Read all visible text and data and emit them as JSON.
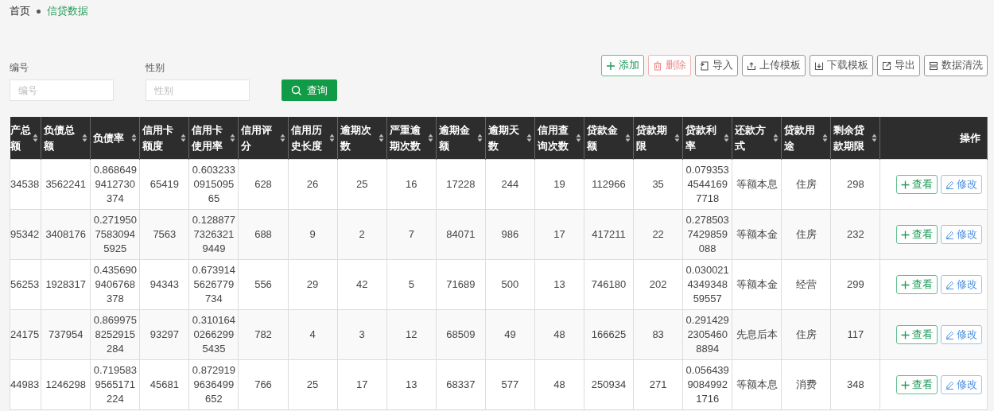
{
  "breadcrumb": [
    {
      "label": "首页",
      "current": false
    },
    {
      "label": "信贷数据",
      "current": true
    }
  ],
  "filters": [
    {
      "label": "编号",
      "placeholder": "编号"
    },
    {
      "label": "性别",
      "placeholder": "性别"
    }
  ],
  "search_button": {
    "label": "查询"
  },
  "toolbar": [
    {
      "label": "添加",
      "kind": "add"
    },
    {
      "label": "删除",
      "kind": "delete"
    },
    {
      "label": "导入",
      "kind": "import"
    },
    {
      "label": "上传模板",
      "kind": "upload"
    },
    {
      "label": "下载模板",
      "kind": "download"
    },
    {
      "label": "导出",
      "kind": "export"
    },
    {
      "label": "数据清洗",
      "kind": "clean"
    }
  ],
  "table": {
    "columns": [
      {
        "label": "产总额",
        "sortable": true
      },
      {
        "label": "负债总额",
        "sortable": true
      },
      {
        "label": "负债率",
        "sortable": true
      },
      {
        "label": "信用卡额度",
        "sortable": true
      },
      {
        "label": "信用卡使用率",
        "sortable": true
      },
      {
        "label": "信用评分",
        "sortable": true
      },
      {
        "label": "信用历史长度",
        "sortable": true
      },
      {
        "label": "逾期次数",
        "sortable": true
      },
      {
        "label": "严重逾期次数",
        "sortable": true
      },
      {
        "label": "逾期金额",
        "sortable": true
      },
      {
        "label": "逾期天数",
        "sortable": true
      },
      {
        "label": "信用查询次数",
        "sortable": true
      },
      {
        "label": "贷款金额",
        "sortable": true
      },
      {
        "label": "贷款期限",
        "sortable": true
      },
      {
        "label": "贷款利率",
        "sortable": true
      },
      {
        "label": "还款方式",
        "sortable": true
      },
      {
        "label": "贷款用途",
        "sortable": true
      },
      {
        "label": "剩余贷款期限",
        "sortable": true
      },
      {
        "label": "操作",
        "sortable": false
      }
    ],
    "rows": [
      {
        "cells": [
          "34538",
          "3562241",
          "0.8686499412730374",
          "65419",
          "0.603233091509565",
          "628",
          "26",
          "25",
          "16",
          "17228",
          "244",
          "19",
          "112966",
          "35",
          "0.07935345441697718",
          "等额本息",
          "住房",
          "298"
        ],
        "actions": [
          {
            "label": "查看",
            "kind": "view"
          },
          {
            "label": "修改",
            "kind": "edit"
          }
        ]
      },
      {
        "cells": [
          "95342",
          "3408176",
          "0.27195075830945925",
          "7563",
          "0.12887773263219449",
          "688",
          "9",
          "2",
          "7",
          "84071",
          "986",
          "17",
          "417211",
          "22",
          "0.2785037429859088",
          "等额本金",
          "住房",
          "232"
        ],
        "actions": [
          {
            "label": "查看",
            "kind": "view"
          },
          {
            "label": "修改",
            "kind": "edit"
          }
        ]
      },
      {
        "cells": [
          "56253",
          "1928317",
          "0.4356909406768378",
          "94343",
          "0.6739145626779734",
          "556",
          "29",
          "42",
          "5",
          "71689",
          "500",
          "13",
          "746180",
          "202",
          "0.030021434934859557",
          "等额本金",
          "经营",
          "299"
        ],
        "actions": [
          {
            "label": "查看",
            "kind": "view"
          },
          {
            "label": "修改",
            "kind": "edit"
          }
        ]
      },
      {
        "cells": [
          "24175",
          "737954",
          "0.8699758252915284",
          "93297",
          "0.31016402662995435",
          "782",
          "4",
          "3",
          "12",
          "68509",
          "49",
          "48",
          "166625",
          "83",
          "0.29142923054608894",
          "先息后本",
          "住房",
          "117"
        ],
        "actions": [
          {
            "label": "查看",
            "kind": "view"
          },
          {
            "label": "修改",
            "kind": "edit"
          }
        ]
      },
      {
        "cells": [
          "44983",
          "1246298",
          "0.7195839565171224",
          "45681",
          "0.8729199636499652",
          "766",
          "25",
          "17",
          "13",
          "68337",
          "577",
          "48",
          "250934",
          "271",
          "0.05643990849921716",
          "等额本息",
          "消费",
          "348"
        ],
        "actions": [
          {
            "label": "查看",
            "kind": "view"
          },
          {
            "label": "修改",
            "kind": "edit"
          }
        ]
      }
    ]
  }
}
